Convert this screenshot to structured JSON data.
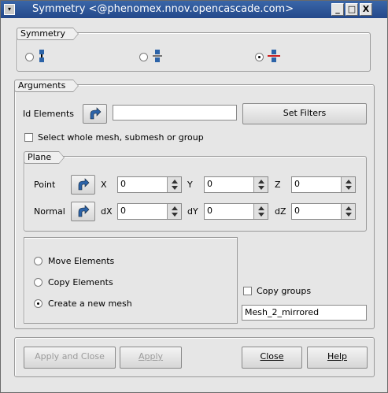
{
  "window": {
    "title": "Symmetry <@phenomex.nnov.opencascade.com>",
    "minimize": "_",
    "maximize": "□",
    "close": "X"
  },
  "symmetry": {
    "label": "Symmetry",
    "options": [
      {
        "icon": "point-symmetry-icon",
        "checked": false
      },
      {
        "icon": "axis-symmetry-icon",
        "checked": false
      },
      {
        "icon": "plane-symmetry-icon",
        "checked": true
      }
    ]
  },
  "arguments": {
    "label": "Arguments",
    "id_elements_label": "Id Elements",
    "id_elements_value": "",
    "set_filters": "Set Filters",
    "select_whole_label": "Select whole mesh, submesh or group"
  },
  "plane": {
    "label": "Plane",
    "point_label": "Point",
    "normal_label": "Normal",
    "x_label": "X",
    "y_label": "Y",
    "z_label": "Z",
    "dx_label": "dX",
    "dy_label": "dY",
    "dz_label": "dZ",
    "x": "0",
    "y": "0",
    "z": "0",
    "dx": "0",
    "dy": "0",
    "dz": "0"
  },
  "action": {
    "move": "Move Elements",
    "copy": "Copy Elements",
    "create": "Create a new mesh",
    "selected": "create",
    "copy_groups": "Copy groups",
    "mesh_name": "Mesh_2_mirrored"
  },
  "buttons": {
    "apply_close": "Apply and Close",
    "apply": "Apply",
    "close": "Close",
    "help": "Help"
  },
  "colors": {
    "titlebar": "#24488a",
    "icon_blue": "#2c63a8"
  }
}
